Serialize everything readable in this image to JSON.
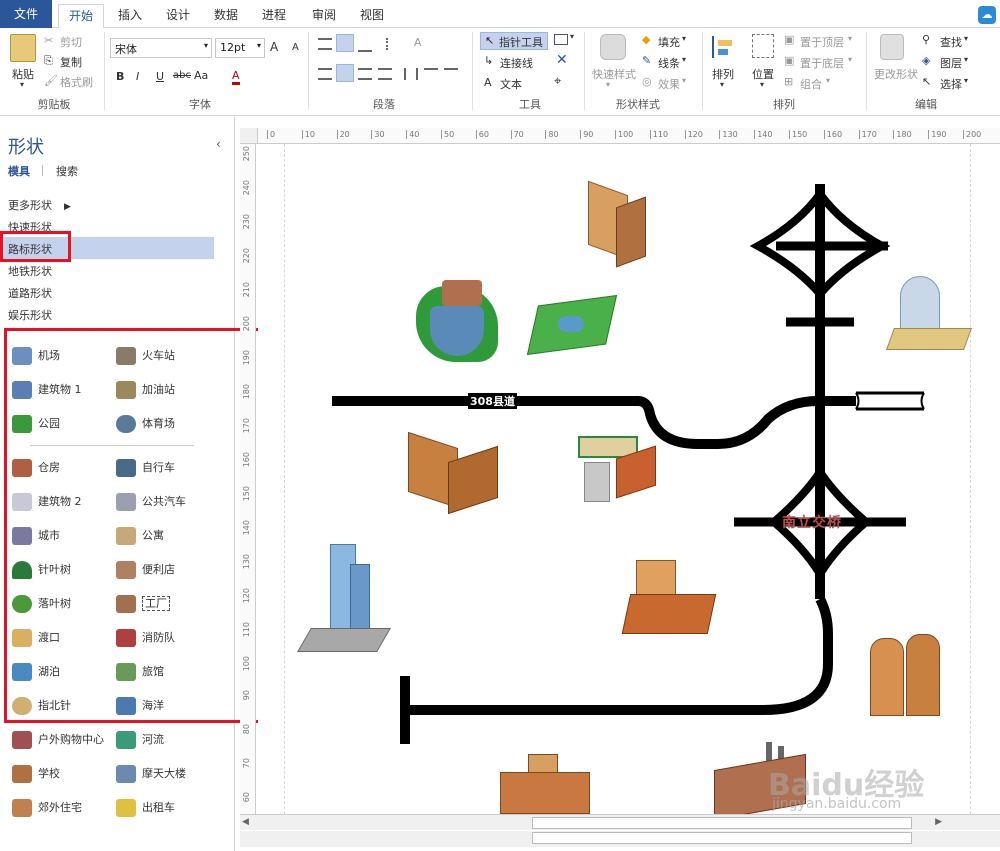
{
  "tabs": {
    "file": "文件",
    "items": [
      "开始",
      "插入",
      "设计",
      "数据",
      "进程",
      "审阅",
      "视图"
    ],
    "active": "开始"
  },
  "ribbon": {
    "clipboard": {
      "paste": "粘贴",
      "cut": "剪切",
      "copy": "复制",
      "format_painter": "格式刷",
      "label": "剪贴板"
    },
    "font": {
      "family": "宋体",
      "size": "12pt",
      "label": "字体",
      "bold": "B",
      "italic": "I",
      "underline": "U",
      "strike": "abc",
      "case": "Aa",
      "color_a": "A",
      "grow": "A",
      "shrink": "A"
    },
    "paragraph": {
      "label": "段落"
    },
    "tools": {
      "pointer": "指针工具",
      "connector": "连接线",
      "text": "文本",
      "label": "工具"
    },
    "shape_styles": {
      "quick": "快速样式",
      "fill": "填充",
      "line": "线条",
      "effect": "效果",
      "label": "形状样式"
    },
    "arrange": {
      "arrange": "排列",
      "position": "位置",
      "bring_front": "置于顶层",
      "send_back": "置于底层",
      "group": "组合",
      "label": "排列"
    },
    "editing": {
      "change_shape": "更改形状",
      "find": "查找",
      "layers": "图层",
      "select": "选择",
      "label": "编辑"
    }
  },
  "panel": {
    "title": "形状",
    "tab_stencils": "模具",
    "tab_search": "搜索",
    "categories": [
      "更多形状",
      "快速形状",
      "路标形状",
      "地铁形状",
      "道路形状",
      "娱乐形状"
    ],
    "selected_category": "路标形状",
    "shapes_left": [
      "机场",
      "建筑物 1",
      "公园",
      "仓房",
      "建筑物 2",
      "城市",
      "针叶树",
      "落叶树",
      "渡口",
      "湖泊",
      "指北针",
      "户外购物中心",
      "学校",
      "郊外住宅"
    ],
    "shapes_right": [
      "火车站",
      "加油站",
      "体育场",
      "自行车",
      "公共汽车",
      "公寓",
      "便利店",
      "工厂",
      "消防队",
      "旅馆",
      "海洋",
      "河流",
      "摩天大楼",
      "出租车"
    ]
  },
  "ruler_top": [
    "0",
    "10",
    "20",
    "30",
    "40",
    "50",
    "60",
    "70",
    "80",
    "90",
    "100",
    "110",
    "120",
    "130",
    "140",
    "150",
    "160",
    "170",
    "180",
    "190",
    "200"
  ],
  "ruler_left": [
    "250",
    "240",
    "230",
    "220",
    "210",
    "200",
    "190",
    "180",
    "170",
    "160",
    "150",
    "140",
    "130",
    "120",
    "110",
    "100",
    "90",
    "80",
    "70",
    "60"
  ],
  "canvas": {
    "road_label": "308县道",
    "interchange_label": "南立交桥"
  },
  "watermark": {
    "brand": "Baidu经验",
    "url": "jingyan.baidu.com"
  },
  "colors": {
    "accent": "#2b579a",
    "selected": "#c5d2ee",
    "highlight_red": "#e81123",
    "road": "#000000",
    "interchange_text": "#c0504d"
  }
}
